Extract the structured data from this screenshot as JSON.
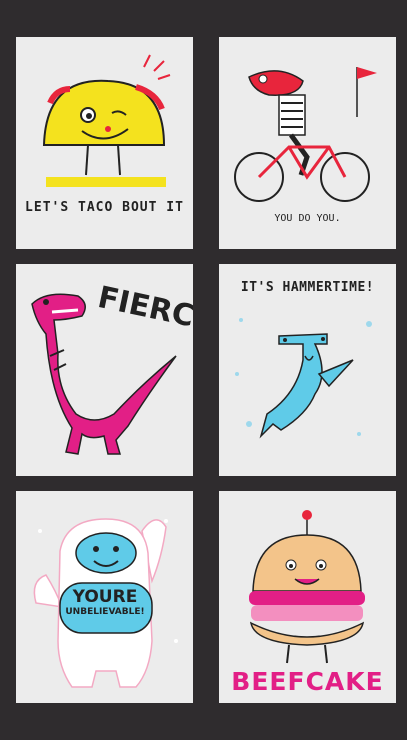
{
  "panels": {
    "taco": {
      "caption": "LET'S TACO BOUT IT"
    },
    "fish": {
      "caption": "YOU DO YOU."
    },
    "dino": {
      "caption": "FIERCE!"
    },
    "shark": {
      "caption": "IT'S HAMMERTIME!"
    },
    "yeti": {
      "caption_line1": "YOURE",
      "caption_line2": "UNBELIEVABLE!"
    },
    "burger": {
      "caption": "BEEFCAKE"
    }
  },
  "colors": {
    "background": "#2f2c2e",
    "panel": "#ececec",
    "pink": "#e21f86",
    "yellow": "#f4e21e",
    "blue": "#5fcbe8",
    "red": "#e8253c"
  }
}
